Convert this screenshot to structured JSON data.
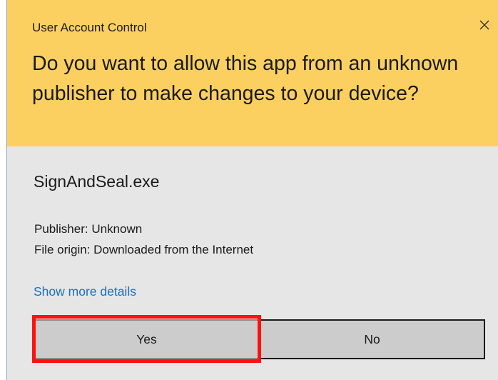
{
  "dialog": {
    "window_title": "User Account Control",
    "close_icon": "close-icon",
    "question": "Do you want to allow this app from an unknown publisher to make changes to your device?",
    "header_color": "#fbd061",
    "body_color": "#e6e6e6"
  },
  "app": {
    "name": "SignAndSeal.exe",
    "publisher_line": "Publisher: Unknown",
    "origin_line": "File origin: Downloaded from the Internet",
    "details_link": "Show more details",
    "link_color": "#1a6fbd"
  },
  "buttons": {
    "yes_label": "Yes",
    "no_label": "No"
  },
  "annotation": {
    "highlight_target": "yes-button",
    "highlight_color": "#ff1010"
  }
}
